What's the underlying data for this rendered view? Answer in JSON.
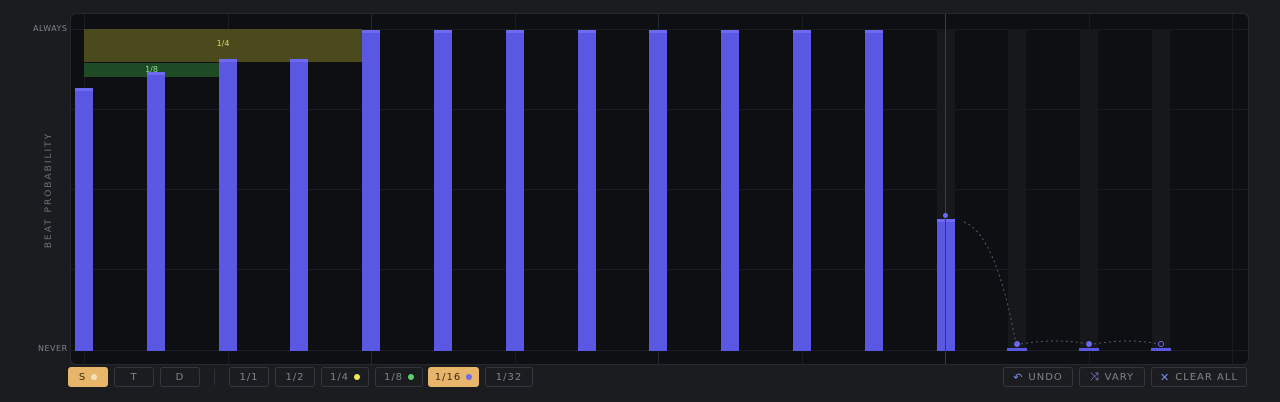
{
  "y_axis": {
    "label": "BEAT PROBABILITY",
    "top_label": "ALWAYS",
    "bottom_label": "NEVER"
  },
  "regions": {
    "quarter_label": "1/4",
    "eighth_label": "1/8"
  },
  "steps": [
    {
      "probability": 0.82
    },
    {
      "probability": 0.87
    },
    {
      "probability": 0.91
    },
    {
      "probability": 0.91
    },
    {
      "probability": 1.0
    },
    {
      "probability": 1.0
    },
    {
      "probability": 1.0
    },
    {
      "probability": 1.0
    },
    {
      "probability": 1.0
    },
    {
      "probability": 1.0
    },
    {
      "probability": 1.0
    },
    {
      "probability": 1.0
    },
    {
      "probability": 0.41
    },
    {
      "probability": 0.0
    },
    {
      "probability": 0.0
    },
    {
      "probability": 0.0
    }
  ],
  "mode_buttons": [
    {
      "label": "S",
      "active": true
    },
    {
      "label": "T",
      "active": false
    },
    {
      "label": "D",
      "active": false
    }
  ],
  "grid_buttons": [
    {
      "label": "1/1",
      "active": false
    },
    {
      "label": "1/2",
      "active": false
    },
    {
      "label": "1/4",
      "active": false,
      "dot_color": "#f2e94e"
    },
    {
      "label": "1/8",
      "active": false,
      "dot_color": "#5ad16a"
    },
    {
      "label": "1/16",
      "active": true,
      "dot_color": "#6d6af0"
    },
    {
      "label": "1/32",
      "active": false
    }
  ],
  "actions": {
    "undo": {
      "label": "UNDO",
      "icon": "undo-icon"
    },
    "vary": {
      "label": "VARY",
      "icon": "shuffle-icon"
    },
    "clear": {
      "label": "CLEAR ALL",
      "icon": "close-icon"
    }
  },
  "colors": {
    "bar": "#5a57e2",
    "active_button": "#e7b66a"
  }
}
